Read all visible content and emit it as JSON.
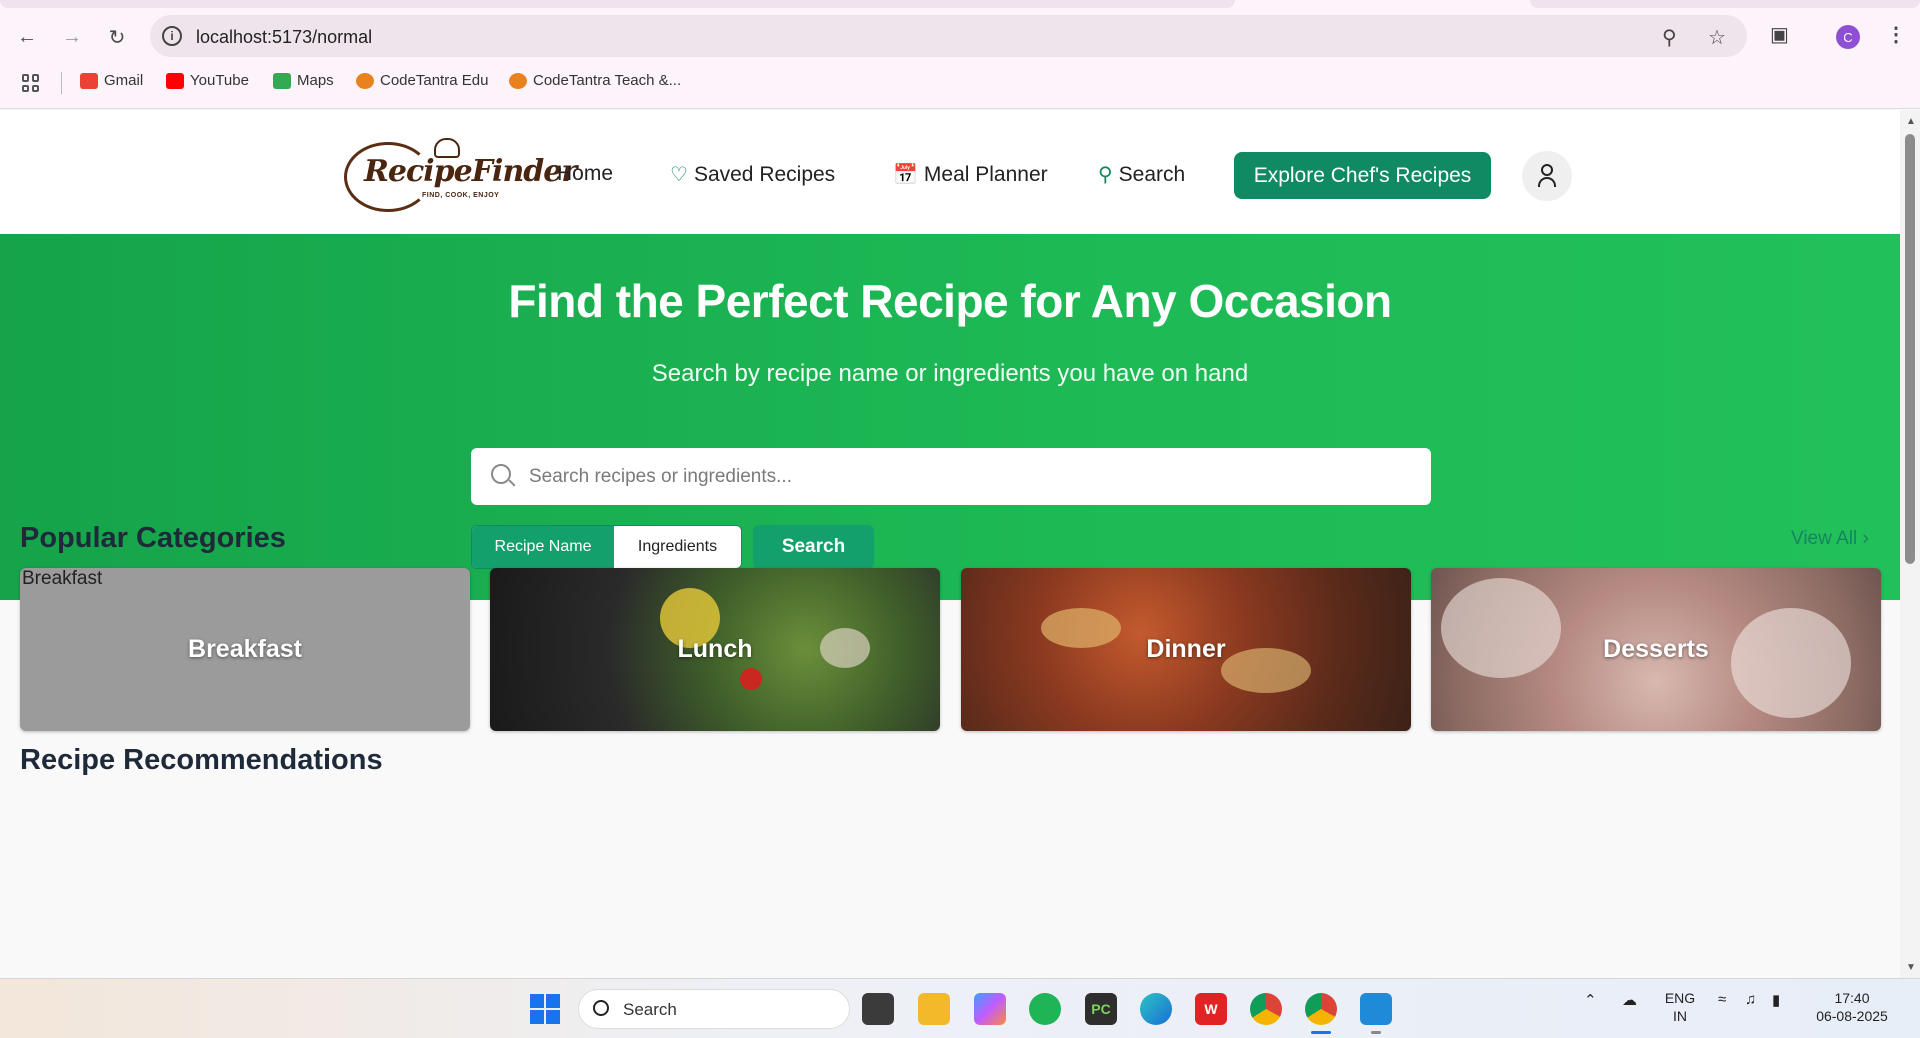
{
  "browser": {
    "url": "localhost:5173/normal",
    "profile_initial": "C",
    "bookmarks": [
      {
        "label": "Gmail",
        "icon": "gmail-icon",
        "color": "#ea4335"
      },
      {
        "label": "YouTube",
        "icon": "youtube-icon",
        "color": "#ff0000"
      },
      {
        "label": "Maps",
        "icon": "maps-icon",
        "color": "#34a853"
      },
      {
        "label": "CodeTantra Edu",
        "icon": "codetantra-icon",
        "color": "#e8821e"
      },
      {
        "label": "CodeTantra Teach &...",
        "icon": "codetantra-icon",
        "color": "#e8821e"
      }
    ]
  },
  "site": {
    "logo_text": "RecipeFinder",
    "logo_tagline": "FIND, COOK, ENJOY",
    "nav": {
      "home": "Home",
      "saved": "Saved Recipes",
      "planner": "Meal Planner",
      "search": "Search"
    },
    "explore_label": "Explore Chef's Recipes",
    "accent_color": "#0f8a62"
  },
  "hero": {
    "title": "Find the Perfect Recipe for Any Occasion",
    "subtitle": "Search by recipe name or ingredients you have on hand",
    "search_placeholder": "Search recipes or ingredients...",
    "search_value": "",
    "mode_recipe": "Recipe Name",
    "mode_ingredients": "Ingredients",
    "active_mode": "Recipe Name",
    "search_button": "Search"
  },
  "categories": {
    "title": "Popular Categories",
    "view_all": "View All",
    "items": [
      {
        "label": "Breakfast",
        "alt_text": "Breakfast"
      },
      {
        "label": "Lunch"
      },
      {
        "label": "Dinner"
      },
      {
        "label": "Desserts"
      }
    ]
  },
  "recommendations": {
    "title": "Recipe Recommendations"
  },
  "taskbar": {
    "search_label": "Search",
    "language": "ENG",
    "region": "IN",
    "time": "17:40",
    "date": "06-08-2025"
  }
}
